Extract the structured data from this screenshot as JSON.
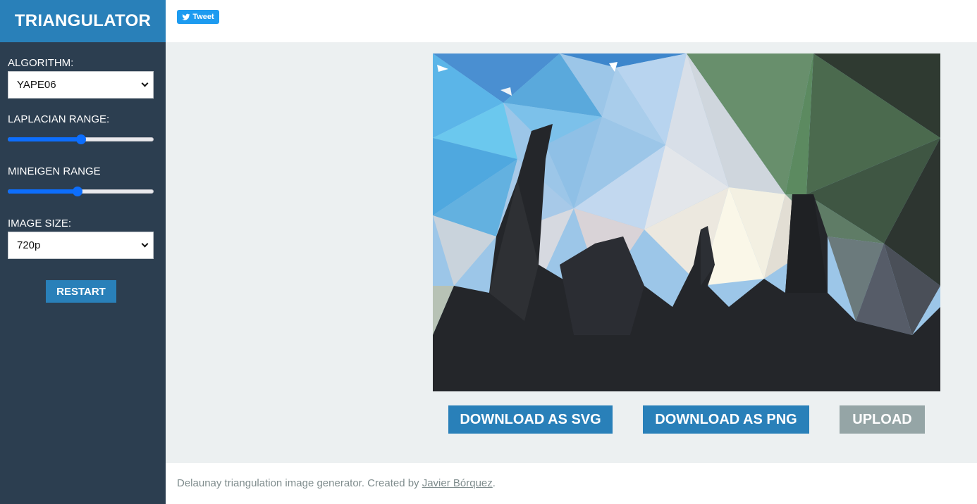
{
  "app": {
    "title": "TRIANGULATOR"
  },
  "sidebar": {
    "algorithm": {
      "label": "ALGORITHM:",
      "value": "YAPE06"
    },
    "laplacian": {
      "label": "LAPLACIAN RANGE:",
      "value_fraction": 0.5
    },
    "mineigen": {
      "label": "MINEIGEN RANGE",
      "value_fraction": 0.48
    },
    "image_size": {
      "label": "IMAGE SIZE:",
      "value": "720p"
    },
    "restart_label": "RESTART"
  },
  "top": {
    "tweet_label": "Tweet"
  },
  "actions": {
    "download_svg": "DOWNLOAD AS SVG",
    "download_png": "DOWNLOAD AS PNG",
    "upload": "UPLOAD"
  },
  "footer": {
    "text": "Delaunay triangulation image generator. Created by ",
    "author": "Javier Bórquez",
    "suffix": "."
  },
  "colors": {
    "sidebar_bg": "#2c3e50",
    "accent": "#2980b9",
    "upload_bg": "#95a5a6",
    "main_bg": "#ecf0f1",
    "tweet_bg": "#1d9bf0"
  }
}
